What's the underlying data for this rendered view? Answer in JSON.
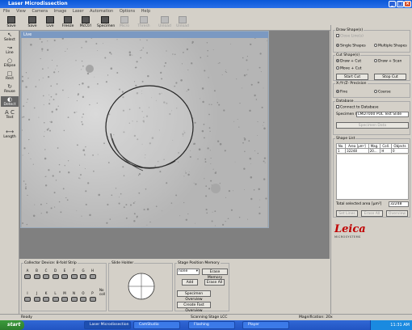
{
  "window": {
    "title": "Laser Microdissection"
  },
  "menu": [
    "File",
    "View",
    "Camera",
    "Image",
    "Laser",
    "Automation",
    "Options",
    "Help"
  ],
  "toolbar": [
    {
      "label": "Save",
      "enabled": true
    },
    {
      "label": "Save",
      "enabled": true
    },
    {
      "label": "Live",
      "enabled": true
    },
    {
      "label": "Freeze",
      "enabled": true
    },
    {
      "label": "McCtrl",
      "enabled": true
    },
    {
      "label": "Specimen",
      "enabled": true
    },
    {
      "label": "Micro",
      "enabled": false
    },
    {
      "label": "Thresh",
      "enabled": false
    },
    {
      "label": "Unload",
      "enabled": false
    },
    {
      "label": "Unload",
      "enabled": false
    }
  ],
  "tools": [
    "Select",
    "Line",
    "Ellipse",
    "Rect",
    "Reuse",
    "Detect",
    "A C",
    "Text",
    "Length"
  ],
  "live": {
    "title": "Live"
  },
  "draw_shapes": {
    "title": "Draw Shape(s)",
    "close_line": "Close Line(s)",
    "single": "Single Shapes",
    "multiple": "Multiple Shapes"
  },
  "cut_shapes": {
    "title": "Cut Shape(s)",
    "draw_cut": "Draw + Cut",
    "draw_scan": "Draw + Scan",
    "move_cut": "Move + Cut",
    "start_cut": "Start Cut",
    "stop_cut": "Stop Cut"
  },
  "precision": {
    "title": "X-/Y-/Z- Precision",
    "fine": "Fine",
    "coarse": "Coarse"
  },
  "database": {
    "title": "Database",
    "connect": "Connect to Database",
    "specimen_label": "Specimen ID",
    "specimen_value": "LMD7000 POL Test Slide",
    "specimen_data": "Specimen Data"
  },
  "shape_list": {
    "title": "Shape List",
    "headers": [
      "No.",
      "Area [µm²]",
      "Mag.",
      "Coll.",
      "Objects"
    ],
    "rows": [
      [
        "1",
        "32248",
        "20...",
        "H",
        "0"
      ]
    ],
    "total_label": "Total selected area [µm²]",
    "total_value": "32248",
    "btn1": "Set Lines",
    "btn2": "Erase All",
    "btn3": "Overview"
  },
  "logo": {
    "brand": "Leica",
    "sub": "MICROSYSTEMS"
  },
  "collector": {
    "title": "Collector Device: 8-fold Strip",
    "top": [
      "A",
      "B",
      "C",
      "D",
      "E",
      "F",
      "G",
      "H"
    ],
    "bottom": [
      "I",
      "J",
      "K",
      "L",
      "M",
      "N",
      "O",
      "P"
    ],
    "no_coll": "No coll"
  },
  "slide_holder": {
    "title": "Slide Holder"
  },
  "stage_memory": {
    "title": "Stage Position Memory",
    "select_value": "none",
    "erase_memory": "Erase Memory",
    "add": "Add",
    "erase_all": "Erase All",
    "specimen_overview": "Specimen Overview",
    "create_fast_overview": "Create Fast Overview"
  },
  "status": {
    "left": "Ready",
    "mid": "Scanning Stage LCC",
    "right": "Magnification: 20x"
  },
  "taskbar": {
    "start": "start",
    "tasks": [
      "Laser Microdissection",
      "CamStudio",
      "Flashing",
      "Player"
    ],
    "clock": "11:31 AM"
  },
  "colors": {
    "title_bar": "#0a58d8",
    "live_bar": "#7b99c2",
    "task_bar": "#2254c2",
    "start": "#3c9a3c"
  }
}
